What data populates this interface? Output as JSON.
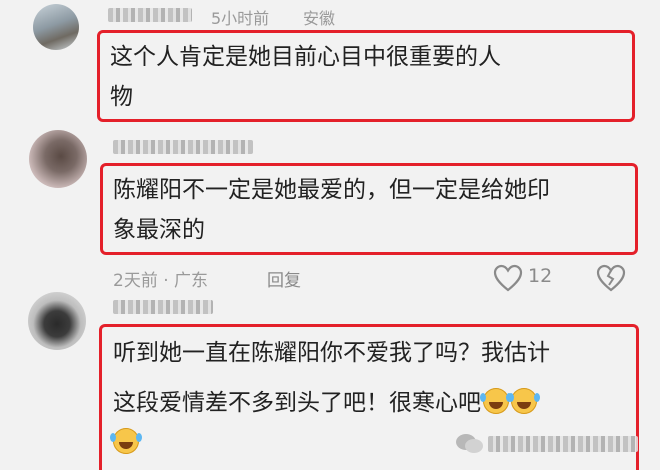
{
  "comments": [
    {
      "time": "5小时前",
      "location": "安徽",
      "lines": [
        "这个人肯定是她目前心目中很重要的人",
        "物"
      ]
    },
    {
      "lines": [
        "陈耀阳不一定是她最爱的，但一定是给她印",
        "象最深的"
      ],
      "time_location": "2天前 · 广东",
      "reply_label": "回复",
      "like_count": "12"
    },
    {
      "lines": [
        "听到她一直在陈耀阳你不爱我了吗？我估计",
        "这段爱情差不多到头了吧！很寒心吧"
      ]
    }
  ],
  "icons": {
    "like": "heart-outline-icon",
    "dislike": "broken-heart-icon",
    "emoji": "tears-of-joy-emoji",
    "watermark": "wechat-icon"
  },
  "colors": {
    "highlight": "#e4202a",
    "meta": "#9a9a9a",
    "text": "#222222"
  }
}
